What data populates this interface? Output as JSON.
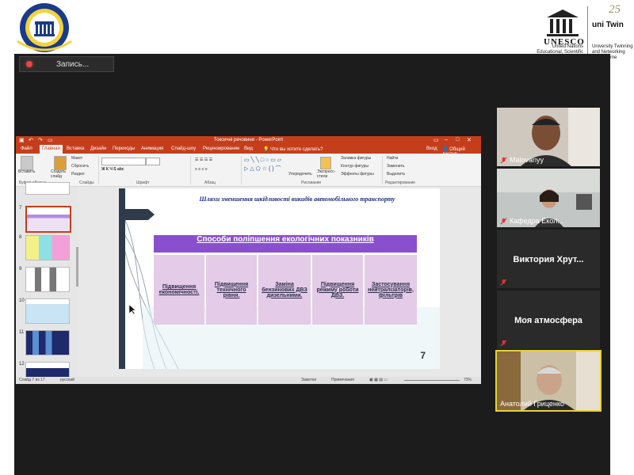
{
  "recording": {
    "label": "Запись..."
  },
  "unesco": {
    "word": "UNESCO",
    "org_text": "United Nations Educational, Scientific and Cultural Organization"
  },
  "unitwin": {
    "number": "25",
    "word": "uni Twin",
    "text": "University Twinning and Networking Programme"
  },
  "ppt": {
    "window_title": "Токсичні речовини - PowerPoint",
    "tabs": [
      "Файл",
      "Главная",
      "Вставка",
      "Дизайн",
      "Переходы",
      "Анимация",
      "Слайд-шоу",
      "Рецензирование",
      "Вид"
    ],
    "active_tab": "Главная",
    "tell_me": "Что вы хотите сделать?",
    "sign_in": "Вход",
    "share": "Общий доступ",
    "ribbon": {
      "paste": "Вставить",
      "new_slide": "Создать слайд",
      "layout": "Макет",
      "reset": "Сбросить",
      "section": "Раздел",
      "arrange": "Упорядочить",
      "quick_styles": "Экспресс-стили",
      "shape_fill": "Заливка фигуры",
      "shape_outline": "Контур фигуры",
      "shape_effects": "Эффекты фигуры",
      "find": "Найти",
      "replace": "Заменить",
      "select": "Выделить",
      "groups": [
        "Буфер обмена",
        "Слайды",
        "Шрифт",
        "Абзац",
        "Рисование",
        "Редактирование"
      ]
    },
    "thumb_numbers": [
      "7",
      "8",
      "9",
      "10",
      "11",
      "12"
    ],
    "status": {
      "slide_of": "Слайд 7 из 17",
      "language": "русский",
      "notes": "Заметки",
      "comments": "Примечания",
      "zoom": "73%"
    }
  },
  "slide": {
    "heading": "Шляхи зменшення шкідливості викидів автомобільного транспорту",
    "banner": "Способи поліпшення екологічних показників",
    "cells": [
      "Підвищення економічності.",
      "Підвищення технічного рівня.",
      "Заміна бензинових ДВЗ дизельними.",
      "Підвищення режиму роботи ДВЗ.",
      "Застосування нейтралізаторів, фільтрів"
    ],
    "number": "7"
  },
  "participants": [
    {
      "name": "Malovanyy",
      "muted": true
    },
    {
      "name": "Кафедра Екол...",
      "muted": true
    },
    {
      "name": "Виктория Хрут...",
      "muted": true
    },
    {
      "name": "Моя атмосфера",
      "muted": true
    },
    {
      "name": "Анатолий Гриценко",
      "muted": false
    }
  ],
  "colors": {
    "ppt_accent": "#c43e1c",
    "banner": "#8a4fcf",
    "cell": "#e4cbe8",
    "active_speaker": "#e4d23a",
    "mute": "#e0333a"
  }
}
